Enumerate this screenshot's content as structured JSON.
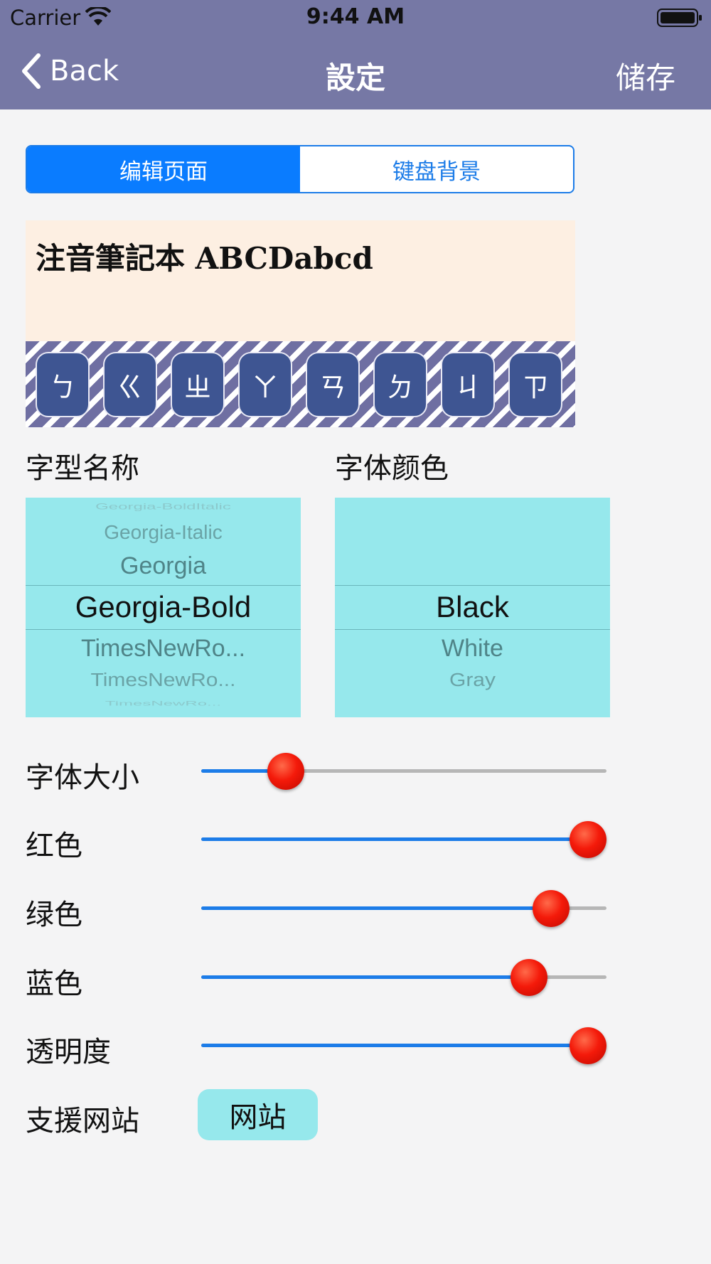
{
  "status_bar": {
    "carrier": "Carrier",
    "time": "9:44 AM"
  },
  "nav": {
    "back_label": "Back",
    "title": "設定",
    "save_label": "储存"
  },
  "segments": [
    {
      "label": "编辑页面",
      "selected": true
    },
    {
      "label": "键盘背景",
      "selected": false
    }
  ],
  "preview": {
    "text": "注音筆記本 ABCDabcd",
    "keys": [
      "ㄅ",
      "ㄍ",
      "ㄓ",
      "ㄚ",
      "ㄢ",
      "ㄉ",
      "ㄐ",
      "ㄗ"
    ]
  },
  "font_name": {
    "label": "字型名称",
    "options": [
      "Georgia-BoldItalic",
      "Georgia-Italic",
      "Georgia",
      "Georgia-Bold",
      "TimesNewRo...",
      "TimesNewRo...",
      "TimesNewRo..."
    ],
    "selected": "Georgia-Bold"
  },
  "font_color": {
    "label": "字体颜色",
    "options": [
      "Black",
      "White",
      "Gray"
    ],
    "selected": "Black"
  },
  "sliders": [
    {
      "label": "字体大小",
      "value": 0.18
    },
    {
      "label": "红色",
      "value": 1.0
    },
    {
      "label": "绿色",
      "value": 0.9
    },
    {
      "label": "蓝色",
      "value": 0.84
    },
    {
      "label": "透明度",
      "value": 1.0
    }
  ],
  "support": {
    "label": "支援网站",
    "button_label": "网站"
  },
  "colors": {
    "nav_bar": "#7678a5",
    "accent": "#0a7cff",
    "picker_bg": "#96e8ec",
    "preview_bg": "#fdefe2",
    "key_bg": "#3e5592",
    "thumb": "#f41a0a"
  }
}
